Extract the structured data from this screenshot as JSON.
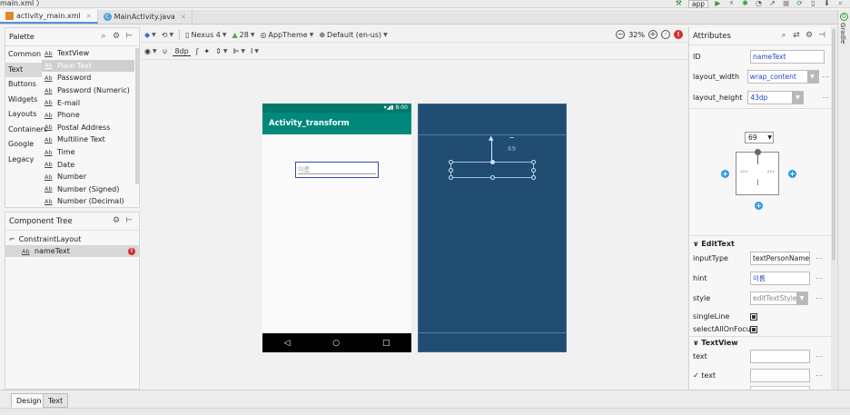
{
  "breadcrumb": "main.xml 〉",
  "run_config": "app",
  "editor_tabs": [
    {
      "label": "activity_main.xml",
      "active": true
    },
    {
      "label": "MainActivity.java",
      "active": false
    }
  ],
  "palette": {
    "title": "Palette",
    "categories": [
      "Common",
      "Text",
      "Buttons",
      "Widgets",
      "Layouts",
      "Containers",
      "Google",
      "Legacy"
    ],
    "selected_category": "Text",
    "items": [
      {
        "label": "TextView"
      },
      {
        "label": "Plain Text",
        "selected": true
      },
      {
        "label": "Password"
      },
      {
        "label": "Password (Numeric)"
      },
      {
        "label": "E-mail"
      },
      {
        "label": "Phone"
      },
      {
        "label": "Postal Address"
      },
      {
        "label": "Multiline Text"
      },
      {
        "label": "Time"
      },
      {
        "label": "Date"
      },
      {
        "label": "Number"
      },
      {
        "label": "Number (Signed)"
      },
      {
        "label": "Number (Decimal)"
      }
    ]
  },
  "component_tree": {
    "title": "Component Tree",
    "root": "ConstraintLayout",
    "child": "nameText"
  },
  "design_toolbar": {
    "device": "Nexus 4",
    "api": "28",
    "theme": "AppTheme",
    "locale": "Default (en-us)",
    "zoom": "32%",
    "margin": "8dp"
  },
  "device_preview": {
    "status_time": "8:00",
    "app_title": "Activity_transform",
    "edit_hint": "이름",
    "nav_icons": [
      "◁",
      "○",
      "□"
    ]
  },
  "blueprint": {
    "margin_label": "69"
  },
  "attributes": {
    "title": "Attributes",
    "id_label": "ID",
    "id_value": "nameText",
    "layout_width_label": "layout_width",
    "layout_width_value": "wrap_content",
    "layout_height_label": "layout_height",
    "layout_height_value": "43dp",
    "constraint_top_value": "69",
    "edittext_section": "EditText",
    "inputType_label": "inputType",
    "inputType_value": "textPersonName",
    "hint_label": "hint",
    "hint_value": "이름",
    "style_label": "style",
    "style_value": "editTextStyle",
    "singleLine_label": "singleLine",
    "selectAllOnFocus_label": "selectAllOnFocus",
    "textview_section": "TextView",
    "text_label": "text",
    "text_tools_label": "text",
    "text_value": "",
    "text_tools_value": ""
  },
  "right_strip": "Gradle",
  "bottom_tabs": [
    "Design",
    "Text"
  ]
}
